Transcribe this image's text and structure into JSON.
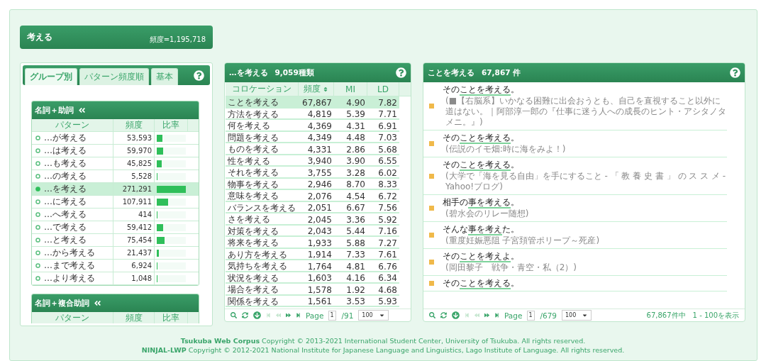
{
  "header": {
    "title": "考える",
    "frequency": "頻度=1,195,718"
  },
  "left_panel": {
    "tabs": [
      {
        "label": "グループ別",
        "selected": true
      },
      {
        "label": "パターン頻度順",
        "selected": false
      },
      {
        "label": "基本",
        "selected": false
      }
    ],
    "groups": [
      {
        "title": "名詞＋助詞",
        "columns": [
          "パターン",
          "頻度",
          "比率"
        ],
        "rows": [
          {
            "pattern": "…が考える",
            "freq": "53,593",
            "level": 0.198,
            "selected": false
          },
          {
            "pattern": "…は考える",
            "freq": "59,970",
            "level": 0.221,
            "selected": false
          },
          {
            "pattern": "…も考える",
            "freq": "45,825",
            "level": 0.169,
            "selected": false
          },
          {
            "pattern": "…の考える",
            "freq": "5,528",
            "level": 0.02,
            "selected": false
          },
          {
            "pattern": "…を考える",
            "freq": "271,291",
            "level": 1,
            "selected": true
          },
          {
            "pattern": "…に考える",
            "freq": "107,911",
            "level": 0.398,
            "selected": false
          },
          {
            "pattern": "…へ考える",
            "freq": "414",
            "level": 0.002,
            "selected": false
          },
          {
            "pattern": "…で考える",
            "freq": "59,412",
            "level": 0.219,
            "selected": false
          },
          {
            "pattern": "…と考える",
            "freq": "75,454",
            "level": 0.278,
            "selected": false
          },
          {
            "pattern": "…から考える",
            "freq": "21,437",
            "level": 0.079,
            "selected": false
          },
          {
            "pattern": "…まで考える",
            "freq": "6,924",
            "level": 0.026,
            "selected": false
          },
          {
            "pattern": "…より考える",
            "freq": "1,048",
            "level": 0.004,
            "selected": false
          }
        ]
      },
      {
        "title": "名詞＋複合助詞",
        "columns": [
          "パターン",
          "頻度",
          "比率"
        ]
      }
    ]
  },
  "collocations": {
    "title": "…を考える",
    "count": "9,059種類",
    "columns": [
      {
        "label": "コロケーション",
        "sorted": false
      },
      {
        "label": "頻度",
        "sorted": true
      },
      {
        "label": "MI",
        "sorted": false
      },
      {
        "label": "LD",
        "sorted": false
      }
    ],
    "rows": [
      {
        "cells": [
          "ことを考える",
          "67,867",
          "4.90",
          "7.82"
        ],
        "selected": true
      },
      {
        "cells": [
          "方法を考える",
          "4,819",
          "5.39",
          "7.71"
        ],
        "selected": false
      },
      {
        "cells": [
          "何を考える",
          "4,369",
          "4.31",
          "6.91"
        ],
        "selected": false
      },
      {
        "cells": [
          "問題を考える",
          "4,349",
          "4.48",
          "7.03"
        ],
        "selected": false
      },
      {
        "cells": [
          "ものを考える",
          "4,331",
          "2.86",
          "5.68"
        ],
        "selected": false
      },
      {
        "cells": [
          "性を考える",
          "3,940",
          "3.90",
          "6.55"
        ],
        "selected": false
      },
      {
        "cells": [
          "それを考える",
          "3,755",
          "3.28",
          "6.02"
        ],
        "selected": false
      },
      {
        "cells": [
          "物事を考える",
          "2,946",
          "8.70",
          "8.33"
        ],
        "selected": false
      },
      {
        "cells": [
          "意味を考える",
          "2,076",
          "4.54",
          "6.72"
        ],
        "selected": false
      },
      {
        "cells": [
          "バランスを考える",
          "2,051",
          "6.67",
          "7.56"
        ],
        "selected": false
      },
      {
        "cells": [
          "さを考える",
          "2,045",
          "3.36",
          "5.92"
        ],
        "selected": false
      },
      {
        "cells": [
          "対策を考える",
          "2,043",
          "5.44",
          "7.16"
        ],
        "selected": false
      },
      {
        "cells": [
          "将来を考える",
          "1,933",
          "5.88",
          "7.27"
        ],
        "selected": false
      },
      {
        "cells": [
          "あり方を考える",
          "1,914",
          "7.33",
          "7.61"
        ],
        "selected": false
      },
      {
        "cells": [
          "気持ちを考える",
          "1,764",
          "4.81",
          "6.76"
        ],
        "selected": false
      },
      {
        "cells": [
          "状況を考える",
          "1,603",
          "4.16",
          "6.34"
        ],
        "selected": false
      },
      {
        "cells": [
          "場合を考える",
          "1,578",
          "1.92",
          "4.68"
        ],
        "selected": false
      },
      {
        "cells": [
          "関係を考える",
          "1,561",
          "3.53",
          "5.93"
        ],
        "selected": false
      }
    ],
    "pager": {
      "nav": [
        {
          "kind": "search",
          "disabled": false
        },
        {
          "kind": "refresh",
          "disabled": false
        },
        {
          "kind": "download",
          "disabled": false
        },
        {
          "kind": "first",
          "disabled": true
        },
        {
          "kind": "prev",
          "disabled": true
        },
        {
          "kind": "next",
          "disabled": false
        },
        {
          "kind": "last",
          "disabled": false
        }
      ],
      "page_label": "Page",
      "page": "1",
      "total": "/91",
      "page_size": "100"
    }
  },
  "concordance": {
    "title": "ことを考える",
    "count": "67,867 件",
    "entries": [
      {
        "pre": "その",
        "key": "ことを考える",
        "post": "。",
        "source": "(■【右脳系】いかなる困難に出会おうとも、自己を直視すること以外に道はない。｜阿部淳一郎の『仕事に迷う人への成長のヒント・アシタノタメニ。』)"
      },
      {
        "pre": "その",
        "key": "ことを考える",
        "post": "。",
        "source": "(伝説のイモ畑:時に海をみよ！)"
      },
      {
        "pre": "その",
        "key": "ことを考える",
        "post": "。",
        "source": "(大学で「海を見る自由」を手にすること - 「 教 養 史 書 」 の ス ス メ - Yahoo!ブログ)"
      },
      {
        "pre": "相手の",
        "key": "事を考える",
        "post": "。",
        "source": "(碧水会のリレー随想)"
      },
      {
        "pre": "そんな",
        "key": "事を考え",
        "post": "た。",
        "source": "(重度妊娠悪阻 子宮頚管ポリープ～死産)"
      },
      {
        "pre": "その",
        "key": "ことを考えよ",
        "post": "。",
        "source": "(岡田黎子　戦争・青空・私（2）)"
      },
      {
        "pre": "その",
        "key": "ことを考える",
        "post": "。"
      }
    ],
    "pager": {
      "nav": [
        {
          "kind": "search",
          "disabled": false
        },
        {
          "kind": "refresh",
          "disabled": false
        },
        {
          "kind": "download",
          "disabled": false
        },
        {
          "kind": "first",
          "disabled": true
        },
        {
          "kind": "prev",
          "disabled": true
        },
        {
          "kind": "next",
          "disabled": false
        },
        {
          "kind": "last",
          "disabled": false
        }
      ],
      "page_label": "Page",
      "page": "1",
      "total": "/679",
      "page_size": "100",
      "summary": "67,867件中　1 - 100を表示"
    }
  },
  "footer": [
    "**Tsukuba Web Corpus** Copyright © 2013-2021 International Student Center, University of Tsukuba. All rights reserved.",
    "**NINJAL-LWP** Copyright © 2012-2021 National Institute for Japanese Language and Linguistics, Lago Institute of Language. All rights reserved."
  ]
}
